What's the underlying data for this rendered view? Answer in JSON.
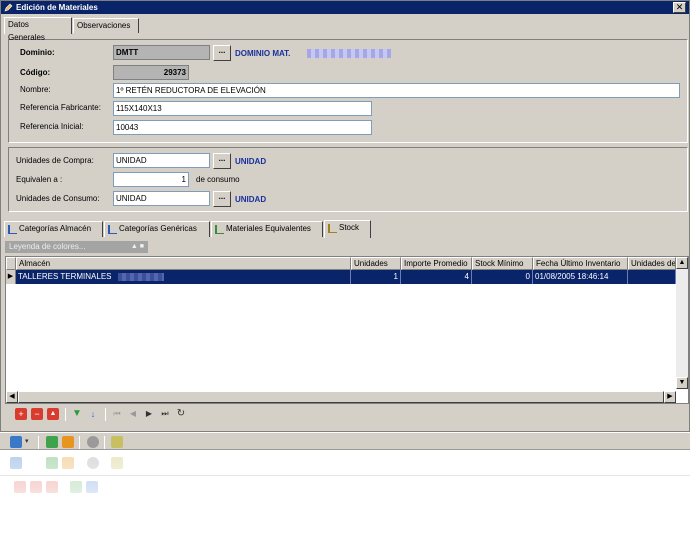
{
  "window": {
    "title": "Edición de Materiales",
    "close_label": "✕"
  },
  "top_tabs": [
    {
      "label": "Datos Generales"
    },
    {
      "label": "Observaciones"
    }
  ],
  "general": {
    "dominio_label": "Dominio:",
    "dominio_value": "DMTT",
    "dominio_desc": "DOMINIO MAT.",
    "codigo_label": "Código:",
    "codigo_value": "29373",
    "nombre_label": "Nombre:",
    "nombre_value": "1º RETÉN REDUCTORA DE ELEVACIÓN",
    "ref_fab_label": "Referencia Fabricante:",
    "ref_fab_value": "115X140X13",
    "ref_ini_label": "Referencia Inicial:",
    "ref_ini_value": "10043",
    "dots_label": "..."
  },
  "units": {
    "compra_label": "Unidades de Compra:",
    "compra_value": "UNIDAD",
    "compra_desc": "UNIDAD",
    "equivalen_label": "Equivalen a :",
    "equivalen_value": "1",
    "consumo_suffix": "de consumo",
    "consumo_label": "Unidades de Consumo:",
    "consumo_value": "UNIDAD",
    "consumo_desc": "UNIDAD"
  },
  "bottom_tabs": [
    {
      "label": "Categorías Almacén"
    },
    {
      "label": "Categorías Genéricas"
    },
    {
      "label": "Materiales Equivalentes"
    },
    {
      "label": "Stock"
    }
  ],
  "legend": {
    "label": "Leyenda de colores...",
    "controls": "▲ ■"
  },
  "grid": {
    "columns": [
      "Almacén",
      "Unidades",
      "Importe Promedio",
      "Stock Mínimo",
      "Fecha Último Inventario",
      "Unidades de"
    ],
    "rows": [
      {
        "almacen": "TALLERES TERMINALES",
        "unidades": "1",
        "importe": "4",
        "stock_minimo": "0",
        "fecha": "01/08/2005 18:46:14",
        "unidades_de": ""
      }
    ],
    "row_indicator": "▶"
  },
  "navbar": {
    "icons": [
      "add-icon",
      "delete-icon",
      "up-icon",
      "filter-icon",
      "sort-icon",
      "first-icon",
      "prev-icon",
      "next-icon",
      "last-icon",
      "refresh-icon"
    ],
    "glyphs": {
      "add": "+",
      "delete": "−",
      "up": "▲",
      "filter": "▼",
      "sort": "↓",
      "first": "⏮",
      "prev": "◀",
      "next": "▶",
      "last": "⏭",
      "refresh": "↻"
    }
  },
  "colors": {
    "titlebar": "#0a246a",
    "selection": "#0a246a",
    "accent_label": "#1a2f9c",
    "face": "#d4d0c8"
  }
}
